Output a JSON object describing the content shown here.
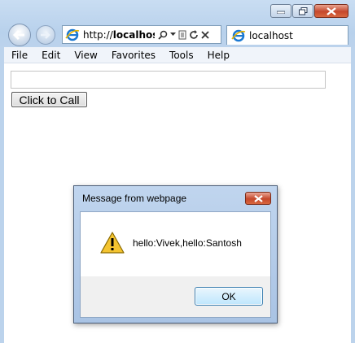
{
  "browser": {
    "address": {
      "prefix": "http://",
      "host": "localhost"
    },
    "tab": {
      "label": "localhost"
    },
    "menu": [
      "File",
      "Edit",
      "View",
      "Favorites",
      "Tools",
      "Help"
    ]
  },
  "page": {
    "input_value": "",
    "call_button_label": "Click to Call"
  },
  "dialog": {
    "title": "Message from webpage",
    "message": "hello:Vivek,hello:Santosh",
    "ok_label": "OK",
    "icon": "warning-icon"
  },
  "colors": {
    "frame": "#b8d1ec",
    "close_button": "#c5482c",
    "ok_button_border": "#3c7fb1"
  }
}
